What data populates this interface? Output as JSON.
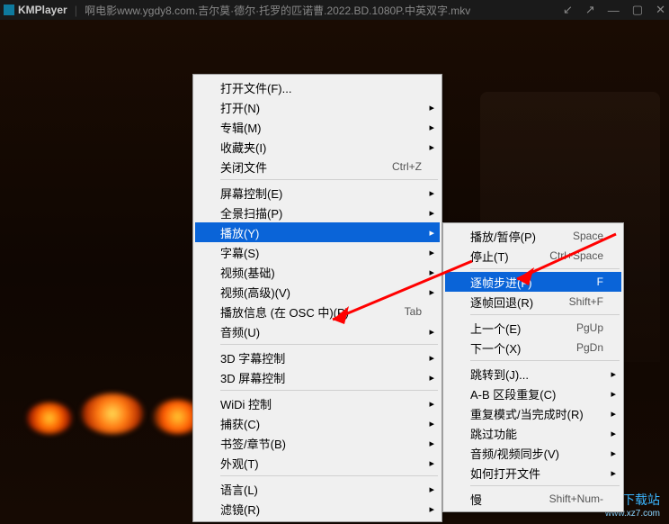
{
  "title": {
    "logo": "KMPlayer",
    "filename": "啊电影www.ygdy8.com.吉尔莫·德尔·托罗的匹诺曹.2022.BD.1080P.中英双字.mkv"
  },
  "titleIcons": [
    "prev-icon",
    "next-icon",
    "sep",
    "minimize-icon",
    "maximize-icon",
    "close-icon"
  ],
  "menuLeft": [
    {
      "t": "item",
      "label": "打开文件(F)...",
      "sub": false
    },
    {
      "t": "item",
      "label": "打开(N)",
      "sub": true
    },
    {
      "t": "item",
      "label": "专辑(M)",
      "sub": true
    },
    {
      "t": "item",
      "label": "收藏夹(I)",
      "sub": true
    },
    {
      "t": "item",
      "label": "关闭文件",
      "sc": "Ctrl+Z",
      "sub": false
    },
    {
      "t": "sep"
    },
    {
      "t": "item",
      "label": "屏幕控制(E)",
      "sub": true
    },
    {
      "t": "item",
      "label": "全景扫描(P)",
      "sub": true
    },
    {
      "t": "item",
      "label": "播放(Y)",
      "sub": true,
      "sel": true
    },
    {
      "t": "item",
      "label": "字幕(S)",
      "sub": true
    },
    {
      "t": "item",
      "label": "视频(基础)",
      "sub": true
    },
    {
      "t": "item",
      "label": "视频(高级)(V)",
      "sub": true
    },
    {
      "t": "item",
      "label": "播放信息 (在 OSC 中)(P)",
      "sc": "Tab",
      "sub": false
    },
    {
      "t": "item",
      "label": "音频(U)",
      "sub": true
    },
    {
      "t": "sep"
    },
    {
      "t": "item",
      "label": "3D 字幕控制",
      "sub": true
    },
    {
      "t": "item",
      "label": "3D 屏幕控制",
      "sub": true
    },
    {
      "t": "sep"
    },
    {
      "t": "item",
      "label": "WiDi 控制",
      "sub": true
    },
    {
      "t": "item",
      "label": "捕获(C)",
      "sub": true
    },
    {
      "t": "item",
      "label": "书签/章节(B)",
      "sub": true
    },
    {
      "t": "item",
      "label": "外观(T)",
      "sub": true
    },
    {
      "t": "sep"
    },
    {
      "t": "item",
      "label": "语言(L)",
      "sub": true
    },
    {
      "t": "item",
      "label": "滤镜(R)",
      "sub": true
    }
  ],
  "menuRight": [
    {
      "t": "item",
      "label": "播放/暂停(P)",
      "sc": "Space"
    },
    {
      "t": "item",
      "label": "停止(T)",
      "sc": "Ctrl+Space"
    },
    {
      "t": "sep"
    },
    {
      "t": "item",
      "label": "逐帧步进(F)",
      "sc": "F",
      "sel": true
    },
    {
      "t": "item",
      "label": "逐帧回退(R)",
      "sc": "Shift+F"
    },
    {
      "t": "sep"
    },
    {
      "t": "item",
      "label": "上一个(E)",
      "sc": "PgUp"
    },
    {
      "t": "item",
      "label": "下一个(X)",
      "sc": "PgDn"
    },
    {
      "t": "sep"
    },
    {
      "t": "item",
      "label": "跳转到(J)...",
      "sub": true
    },
    {
      "t": "item",
      "label": "A-B 区段重复(C)",
      "sub": true
    },
    {
      "t": "item",
      "label": "重复模式/当完成时(R)",
      "sub": true
    },
    {
      "t": "item",
      "label": "跳过功能",
      "sub": true
    },
    {
      "t": "item",
      "label": "音频/视频同步(V)",
      "sub": true
    },
    {
      "t": "item",
      "label": "如何打开文件",
      "sub": true
    },
    {
      "t": "sep"
    },
    {
      "t": "item",
      "label": "慢",
      "sc": "Shift+Num-"
    }
  ],
  "watermark": {
    "main": "极光下载站",
    "sub": "www.xz7.com"
  }
}
